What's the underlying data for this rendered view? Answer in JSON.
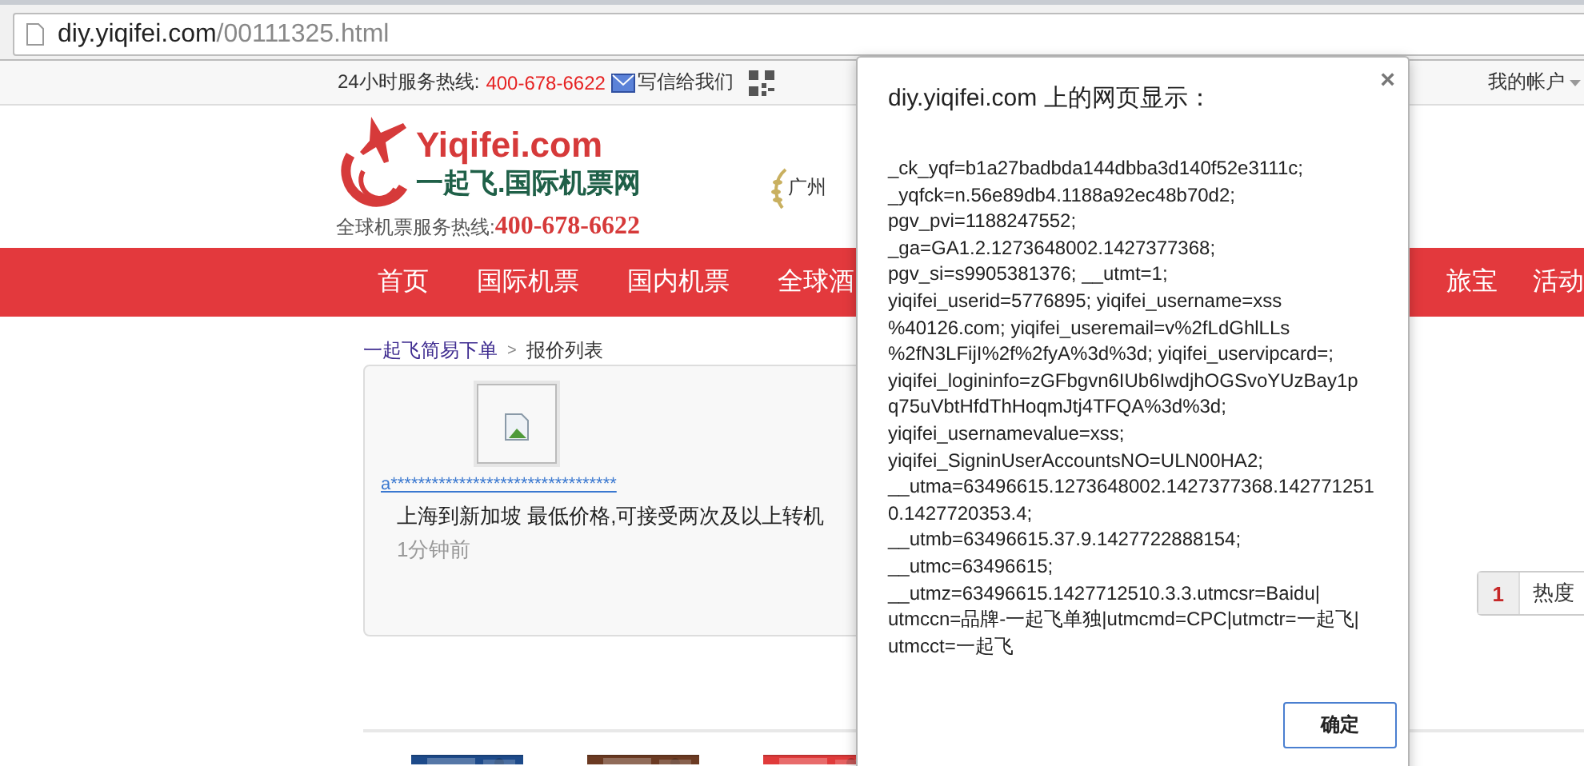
{
  "address_bar": {
    "host": "diy.yiqifei.com",
    "path": "/00111325.html"
  },
  "top_bar": {
    "hotline_label": "24小时服务热线:",
    "hotline_number": "400-678-6622",
    "mail_link": "写信给我们",
    "account_menu": "我的帐户"
  },
  "header": {
    "logo_brand": "Yiqifei.com",
    "logo_name": "一起飞.国际机票网",
    "hotline_label": "全球机票服务热线:",
    "hotline_number": "400-678-6622",
    "city": "广州"
  },
  "nav_left": [
    {
      "label": "首页"
    },
    {
      "label": "国际机票"
    },
    {
      "label": "国内机票"
    },
    {
      "label": "全球酒"
    }
  ],
  "nav_right": [
    {
      "label": "旅宝"
    },
    {
      "label": "活动"
    }
  ],
  "breadcrumb": {
    "link": "一起飞简易下单",
    "separator": ">",
    "current": "报价列表"
  },
  "quote_card": {
    "user": "a*********************************",
    "description": "上海到新加坡 最低价格,可接受两次及以上转机",
    "time": "1分钟前"
  },
  "sort_bar": {
    "rank": "1",
    "label": "热度"
  },
  "dialog": {
    "title": "diy.yiqifei.com 上的网页显示：",
    "message": "_ck_yqf=b1a27badbda144dbba3d140f52e3111c;\n_yqfck=n.56e89db4.1188a92ec48b70d2;\npgv_pvi=1188247552;\n_ga=GA1.2.1273648002.1427377368;\npgv_si=s9905381376; __utmt=1;\nyiqifei_userid=5776895; yiqifei_username=xss\n%40126.com; yiqifei_useremail=v%2fLdGhlLLs\n%2fN3LFijI%2f%2fyA%3d%3d; yiqifei_uservipcard=;\nyiqifei_logininfo=zGFbgvn6IUb6IwdjhOGSvoYUzBay1p\nq75uVbtHfdThHoqmJtj4TFQA%3d%3d;\nyiqifei_usernamevalue=xss;\nyiqifei_SigninUserAccountsNO=ULN00HA2;\n__utma=63496615.1273648002.1427377368.142771251\n0.1427720353.4;\n__utmb=63496615.37.9.1427722888154;\n__utmc=63496615;\n__utmz=63496615.1427712510.3.3.utmcsr=Baidu|\nutmccn=品牌-一起飞单独|utmcmd=CPC|utmctr=一起飞|\nutmcct=一起飞",
    "close": "×",
    "ok_button": "确定"
  }
}
